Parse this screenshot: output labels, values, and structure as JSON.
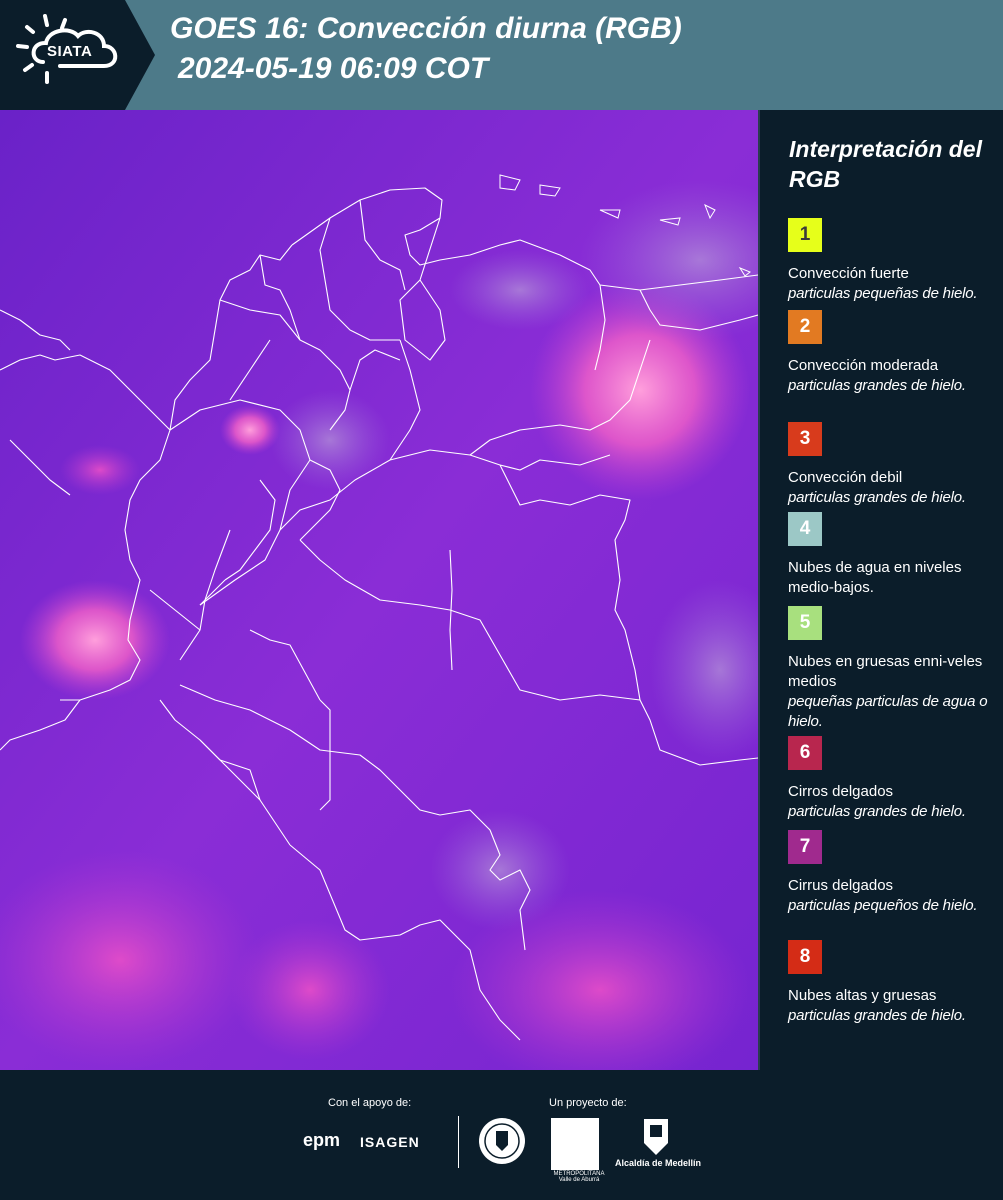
{
  "header": {
    "logo_text": "SIATA",
    "title_line1": "GOES 16: Convección diurna (RGB)",
    "title_line2": "2024-05-19 06:09 COT",
    "background_color": "#4d7a89",
    "logo_panel_color": "#0b1d2a"
  },
  "map": {
    "description_icon": "satellite-rgb-map",
    "base_color": "#7a28d0",
    "border_color": "#ffffff"
  },
  "legend": {
    "title": "Interpretación del RGB",
    "items": [
      {
        "number": "1",
        "color": "#e6ff1a",
        "label": "Convección fuerte",
        "sub": "particulas pequeñas de hielo."
      },
      {
        "number": "2",
        "color": "#e27a22",
        "label": "Convección moderada",
        "sub": "particulas grandes de hielo."
      },
      {
        "number": "3",
        "color": "#d83b1c",
        "label": "Convección debil",
        "sub": "particulas grandes de hielo."
      },
      {
        "number": "4",
        "color": "#9cc8c6",
        "label": "Nubes de agua en niveles medio-bajos.",
        "sub": ""
      },
      {
        "number": "5",
        "color": "#a8e07e",
        "label": "Nubes en gruesas enni-veles medios",
        "sub": "pequeñas particulas de agua o hielo."
      },
      {
        "number": "6",
        "color": "#b8264e",
        "label": "Cirros delgados",
        "sub": "particulas grandes de hielo."
      },
      {
        "number": "7",
        "color": "#a02a8e",
        "label": "Cirrus delgados",
        "sub": "particulas pequeños de hielo."
      },
      {
        "number": "8",
        "color": "#d42c16",
        "label": "Nubes altas y gruesas",
        "sub": "particulas grandes de hielo."
      }
    ]
  },
  "footer": {
    "support_label": "Con el apoyo de:",
    "project_label": "Un proyecto de:",
    "epm": "epm",
    "isagen": "ISAGEN",
    "metro_text": "METROPOLITANA Valle de Aburrá",
    "alcaldia": "Alcaldía de Medellín"
  }
}
